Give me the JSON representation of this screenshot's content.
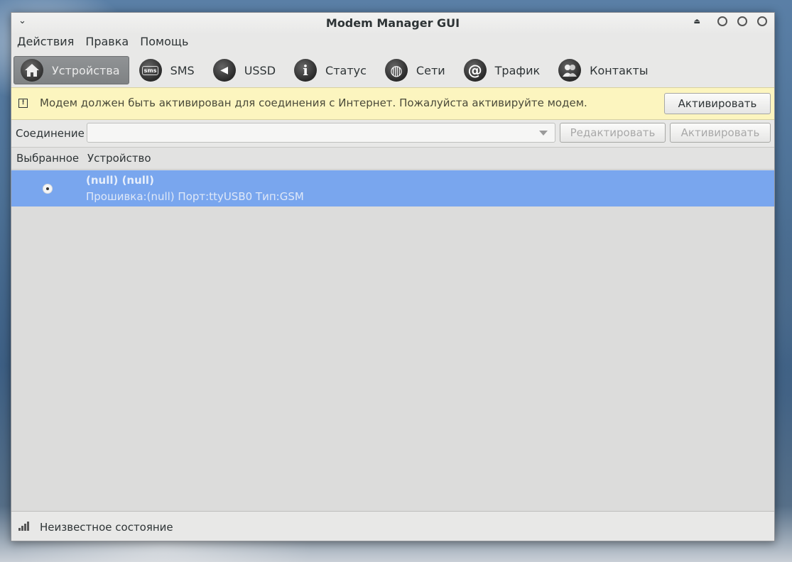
{
  "window": {
    "title": "Modem Manager GUI"
  },
  "menubar": {
    "items": [
      "Действия",
      "Правка",
      "Помощь"
    ]
  },
  "toolbar": {
    "items": [
      {
        "label": "Устройства",
        "icon": "home-icon"
      },
      {
        "label": "SMS",
        "icon": "sms-icon",
        "glyph": "sms"
      },
      {
        "label": "USSD",
        "icon": "ussd-icon",
        "glyph": "◀"
      },
      {
        "label": "Статус",
        "icon": "info-icon",
        "glyph": "i"
      },
      {
        "label": "Сети",
        "icon": "globe-icon",
        "glyph": "◍"
      },
      {
        "label": "Трафик",
        "icon": "at-icon",
        "glyph": "@"
      },
      {
        "label": "Контакты",
        "icon": "contacts-icon",
        "glyph": "👥"
      }
    ],
    "active_index": 0
  },
  "infobar": {
    "message": "Модем должен быть активирован для соединения с Интернет. Пожалуйста активируйте модем.",
    "button": "Активировать"
  },
  "connection": {
    "label": "Соединение",
    "value": "",
    "edit_button": "Редактировать",
    "activate_button": "Активировать"
  },
  "devices": {
    "columns": [
      "Выбранное",
      "Устройство"
    ],
    "rows": [
      {
        "title": "(null) (null)",
        "details": "Прошивка:(null) Порт:ttyUSB0 Тип:GSM",
        "selected": true
      }
    ]
  },
  "statusbar": {
    "text": "Неизвестное состояние"
  },
  "colors": {
    "selection": "#79a6ee",
    "infobar": "#fcf5bf"
  }
}
